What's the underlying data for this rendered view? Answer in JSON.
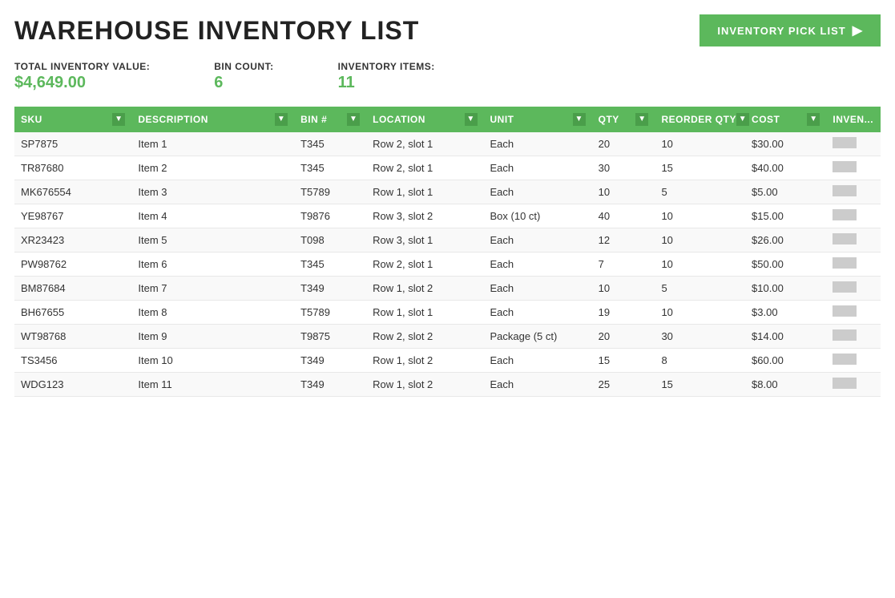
{
  "header": {
    "title": "WAREHOUSE INVENTORY LIST",
    "pick_list_button": "INVENTORY  PICK LIST"
  },
  "stats": {
    "total_inventory_label": "TOTAL INVENTORY VALUE:",
    "total_inventory_value": "$4,649.00",
    "bin_count_label": "BIN COUNT:",
    "bin_count_value": "6",
    "inventory_items_label": "INVENTORY ITEMS:",
    "inventory_items_value": "11"
  },
  "table": {
    "columns": [
      {
        "key": "sku",
        "label": "SKU"
      },
      {
        "key": "description",
        "label": "DESCRIPTION"
      },
      {
        "key": "bin",
        "label": "BIN #"
      },
      {
        "key": "location",
        "label": "LOCATION"
      },
      {
        "key": "unit",
        "label": "UNIT"
      },
      {
        "key": "qty",
        "label": "QTY"
      },
      {
        "key": "reorder_qty",
        "label": "REORDER QTY"
      },
      {
        "key": "cost",
        "label": "COST"
      },
      {
        "key": "inv",
        "label": "INVEN..."
      }
    ],
    "rows": [
      {
        "sku": "SP7875",
        "description": "Item 1",
        "bin": "T345",
        "location": "Row 2, slot 1",
        "unit": "Each",
        "qty": 20,
        "reorder_qty": 10,
        "cost": "$30.00",
        "inv_color": "light"
      },
      {
        "sku": "TR87680",
        "description": "Item 2",
        "bin": "T345",
        "location": "Row 2, slot 1",
        "unit": "Each",
        "qty": 30,
        "reorder_qty": 15,
        "cost": "$40.00",
        "inv_color": "light"
      },
      {
        "sku": "MK676554",
        "description": "Item 3",
        "bin": "T5789",
        "location": "Row 1, slot 1",
        "unit": "Each",
        "qty": 10,
        "reorder_qty": 5,
        "cost": "$5.00",
        "inv_color": "light"
      },
      {
        "sku": "YE98767",
        "description": "Item 4",
        "bin": "T9876",
        "location": "Row 3, slot 2",
        "unit": "Box (10 ct)",
        "qty": 40,
        "reorder_qty": 10,
        "cost": "$15.00",
        "inv_color": "light"
      },
      {
        "sku": "XR23423",
        "description": "Item 5",
        "bin": "T098",
        "location": "Row 3, slot 1",
        "unit": "Each",
        "qty": 12,
        "reorder_qty": 10,
        "cost": "$26.00",
        "inv_color": "light"
      },
      {
        "sku": "PW98762",
        "description": "Item 6",
        "bin": "T345",
        "location": "Row 2, slot 1",
        "unit": "Each",
        "qty": 7,
        "reorder_qty": 10,
        "cost": "$50.00",
        "inv_color": "light"
      },
      {
        "sku": "BM87684",
        "description": "Item 7",
        "bin": "T349",
        "location": "Row 1, slot 2",
        "unit": "Each",
        "qty": 10,
        "reorder_qty": 5,
        "cost": "$10.00",
        "inv_color": "light"
      },
      {
        "sku": "BH67655",
        "description": "Item 8",
        "bin": "T5789",
        "location": "Row 1, slot 1",
        "unit": "Each",
        "qty": 19,
        "reorder_qty": 10,
        "cost": "$3.00",
        "inv_color": "light"
      },
      {
        "sku": "WT98768",
        "description": "Item 9",
        "bin": "T9875",
        "location": "Row 2, slot 2",
        "unit": "Package (5 ct)",
        "qty": 20,
        "reorder_qty": 30,
        "cost": "$14.00",
        "inv_color": "light"
      },
      {
        "sku": "TS3456",
        "description": "Item 10",
        "bin": "T349",
        "location": "Row 1, slot 2",
        "unit": "Each",
        "qty": 15,
        "reorder_qty": 8,
        "cost": "$60.00",
        "inv_color": "light"
      },
      {
        "sku": "WDG123",
        "description": "Item 11",
        "bin": "T349",
        "location": "Row 1, slot 2",
        "unit": "Each",
        "qty": 25,
        "reorder_qty": 15,
        "cost": "$8.00",
        "inv_color": "light"
      }
    ]
  },
  "colors": {
    "green": "#5cb85c",
    "header_bg": "#5cb85c"
  }
}
